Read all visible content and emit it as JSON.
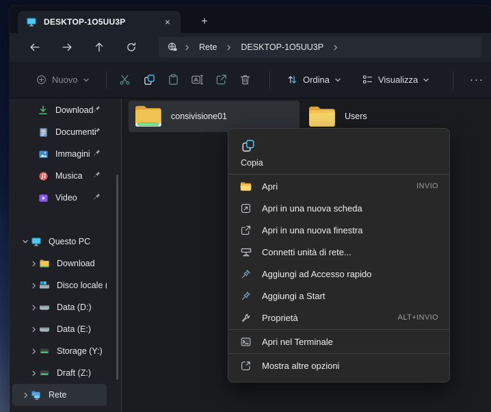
{
  "colors": {
    "accent_blue": "#4cc2ff",
    "folder_yellow": "#f3c64f",
    "selection_gray": "#2e3135",
    "menu_bg": "#282829"
  },
  "window": {
    "tab": {
      "title": "DESKTOP-1O5UU3P",
      "close_glyph": "×",
      "new_tab_glyph": "+"
    },
    "breadcrumb": {
      "items": [
        "Rete",
        "DESKTOP-1O5UU3P"
      ]
    }
  },
  "toolbar": {
    "new_label": "Nuovo",
    "sort_label": "Ordina",
    "view_label": "Visualizza",
    "more_glyph": "···",
    "icons": [
      "cut",
      "copy",
      "paste",
      "rename",
      "share",
      "delete"
    ]
  },
  "sidebar": {
    "quick": [
      {
        "label": "Download",
        "icon": "download"
      },
      {
        "label": "Documenti",
        "icon": "document"
      },
      {
        "label": "Immagini",
        "icon": "picture"
      },
      {
        "label": "Musica",
        "icon": "music"
      },
      {
        "label": "Video",
        "icon": "video"
      }
    ],
    "tree": [
      {
        "label": "Questo PC",
        "icon": "pc",
        "expanded": true
      },
      {
        "label": "Download",
        "icon": "folder"
      },
      {
        "label": "Disco locale (C",
        "icon": "os-drive"
      },
      {
        "label": "Data (D:)",
        "icon": "drive"
      },
      {
        "label": "Data (E:)",
        "icon": "drive"
      },
      {
        "label": "Storage (Y:)",
        "icon": "net-drive"
      },
      {
        "label": "Draft (Z:)",
        "icon": "net-drive"
      },
      {
        "label": "Rete",
        "icon": "network",
        "selected": true
      }
    ]
  },
  "files": [
    {
      "name": "consivisione01",
      "icon": "shared-folder",
      "selected": true
    },
    {
      "name": "Users",
      "icon": "folder",
      "selected": false
    }
  ],
  "context_menu": {
    "quick_actions": [
      {
        "label": "Copia",
        "icon": "copy"
      }
    ],
    "items": [
      {
        "label": "Apri",
        "shortcut": "INVIO",
        "icon": "open-folder"
      },
      {
        "label": "Apri in una nuova scheda",
        "shortcut": "",
        "icon": "new-tab"
      },
      {
        "label": "Apri in una nuova finestra",
        "shortcut": "",
        "icon": "new-window"
      },
      {
        "label": "Connetti unità di rete...",
        "shortcut": "",
        "icon": "map-drive"
      },
      {
        "label": "Aggiungi ad Accesso rapido",
        "shortcut": "",
        "icon": "pin"
      },
      {
        "label": "Aggiungi a Start",
        "shortcut": "",
        "icon": "pin"
      },
      {
        "label": "Proprietà",
        "shortcut": "ALT+INVIO",
        "icon": "properties"
      },
      {
        "label": "Apri nel Terminale",
        "shortcut": "",
        "icon": "terminal"
      },
      {
        "label": "Mostra altre opzioni",
        "shortcut": "",
        "icon": "more-options"
      }
    ]
  }
}
